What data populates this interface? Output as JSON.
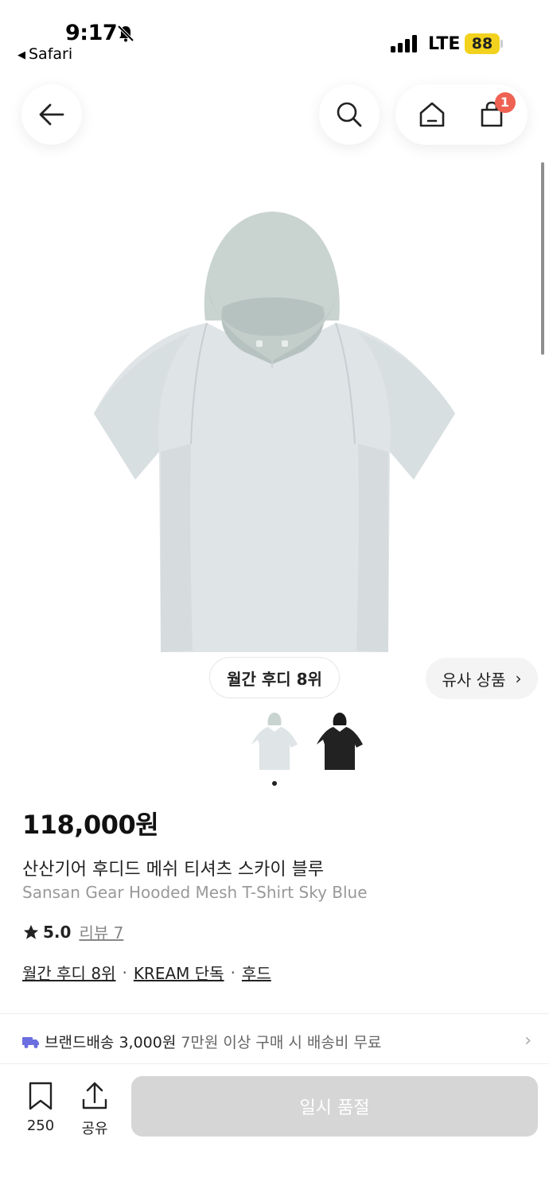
{
  "status_bar": {
    "time": "9:17",
    "back_app": "Safari",
    "network": "LTE",
    "battery": "88"
  },
  "nav": {
    "cart_count": "1"
  },
  "product": {
    "rank_badge": "월간 후디 8위",
    "similar_label": "유사 상품",
    "price": "118,000원",
    "name_ko": "산산기어 후디드 메쉬 티셔츠 스카이 블루",
    "name_en": "Sansan Gear Hooded Mesh T-Shirt Sky Blue",
    "rating": "5.0",
    "reviews": "리뷰 7",
    "tags": [
      "월간 후디 8위",
      "KREAM 단독",
      "후드"
    ]
  },
  "shipping": {
    "label": "브랜드배송 3,000원",
    "condition": "7만원 이상 구매 시 배송비 무료"
  },
  "bottom_bar": {
    "save_count": "250",
    "share_label": "공유",
    "buy_label": "일시 품절"
  },
  "colors": {
    "shirt": "#dde3e4",
    "hood": "#c9d3d0",
    "badge": "#ef6253",
    "soldout": "#d6d6d6",
    "battery": "#f2d21e"
  }
}
